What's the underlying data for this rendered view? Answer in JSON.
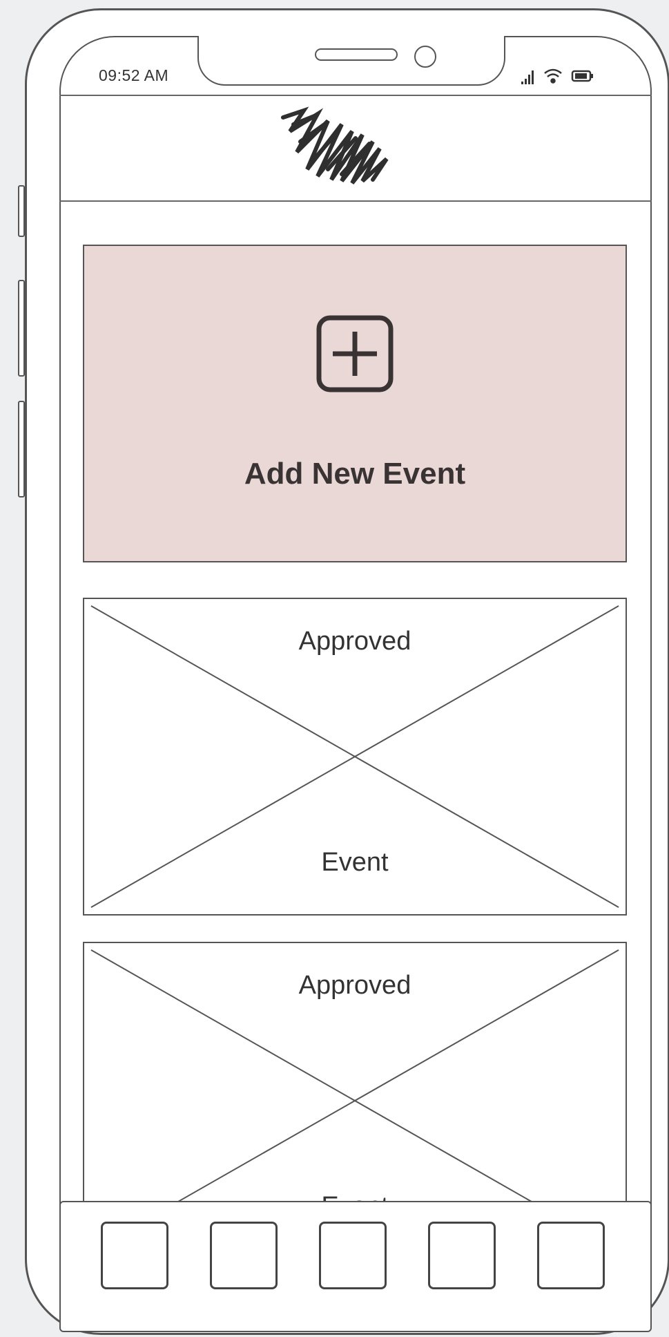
{
  "status_bar": {
    "time": "09:52 AM",
    "icons": [
      "signal-icon",
      "wifi-icon",
      "battery-icon"
    ]
  },
  "header": {
    "logo": "scribble-logo"
  },
  "add_event": {
    "label": "Add New Event",
    "icon": "plus-square-icon",
    "background": "#ead8d7"
  },
  "events": [
    {
      "status": "Approved",
      "title": "Event"
    },
    {
      "status": "Approved",
      "title": "Event"
    }
  ],
  "tab_bar": {
    "tabs": [
      "tab-1",
      "tab-2",
      "tab-3",
      "tab-4",
      "tab-5"
    ]
  }
}
